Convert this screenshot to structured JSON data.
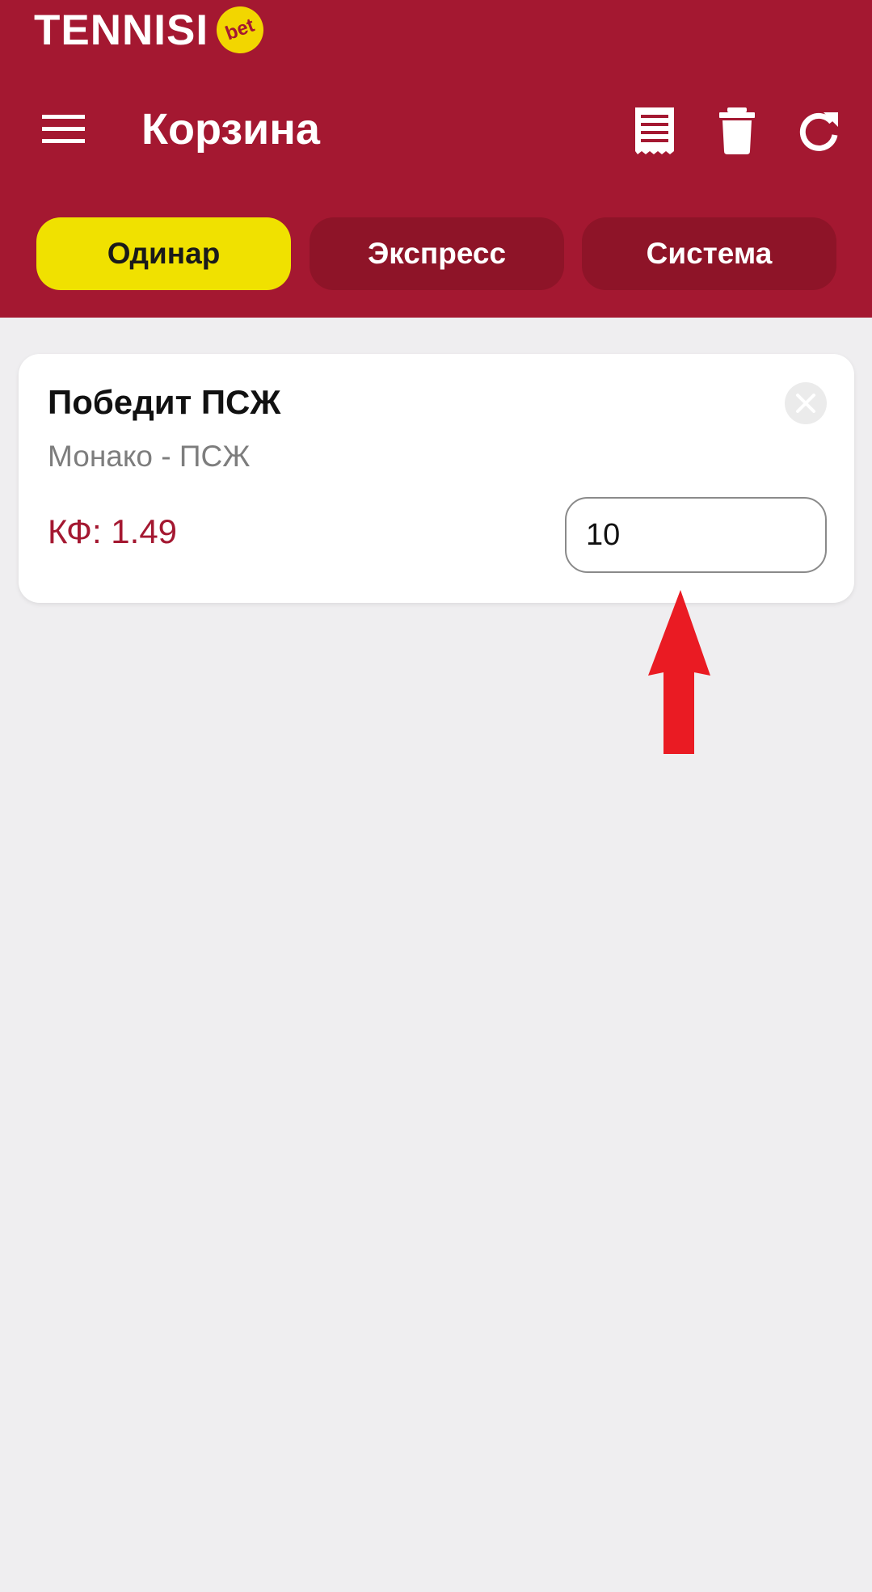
{
  "app": {
    "logo_text": "TENNISI",
    "logo_badge": "bet"
  },
  "header": {
    "title": "Корзина",
    "icons": [
      "menu-icon",
      "receipt-icon",
      "trash-icon",
      "refresh-icon"
    ]
  },
  "tabs": [
    {
      "label": "Одинар",
      "active": true
    },
    {
      "label": "Экспресс",
      "active": false
    },
    {
      "label": "Система",
      "active": false
    }
  ],
  "bet": {
    "title": "Победит ПСЖ",
    "event": "Монако - ПСЖ",
    "odds": "КФ: 1.49",
    "stake_value": "10"
  },
  "colors": {
    "header_bg": "#a41831",
    "active_tab": "#f0e100",
    "inactive_tab": "#8e1428",
    "page_bg": "#efeef0",
    "arrow": "#ea1b23"
  }
}
